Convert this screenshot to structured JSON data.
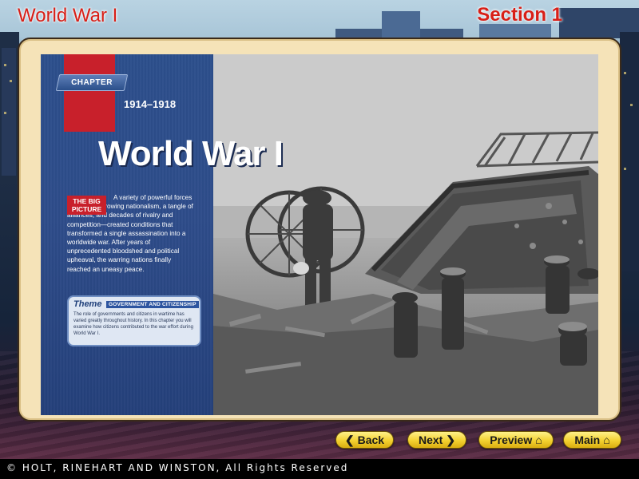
{
  "header": {
    "title": "World War I",
    "section": "Section 1"
  },
  "page": {
    "chapter_label": "CHAPTER",
    "years": "1914–1918",
    "title": "World War I",
    "big_picture_label_line1": "THE BIG",
    "big_picture_label_line2": "PICTURE",
    "big_picture_text": "A variety of powerful forces—including growing nationalism, a tangle of alliances, and decades of rivalry and competition—created conditions that transformed a single assassination into a worldwide war. After years of unprecedented bloodshed and political upheaval, the warring nations finally reached an uneasy peace.",
    "theme_label": "Theme",
    "theme_badge": "GOVERNMENT AND CITIZENSHIP",
    "theme_text": "The role of governments and citizens in wartime has varied greatly throughout history. In this chapter you will examine how citizens contributed to the war effort during World War I."
  },
  "nav": {
    "back_label": "Back",
    "next_label": "Next",
    "preview_label": "Preview",
    "main_label": "Main"
  },
  "footer": {
    "copyright": "© HOLT, RINEHART AND WINSTON, All Rights Reserved"
  },
  "colors": {
    "header_red": "#d81f17",
    "button_yellow": "#f3d130",
    "panel_blue": "#2c4f8c",
    "frame_cream": "#f5e3b8"
  },
  "icons": {
    "back": "chevron-left-icon",
    "next": "chevron-right-icon",
    "preview": "home-icon",
    "main": "home-icon"
  }
}
